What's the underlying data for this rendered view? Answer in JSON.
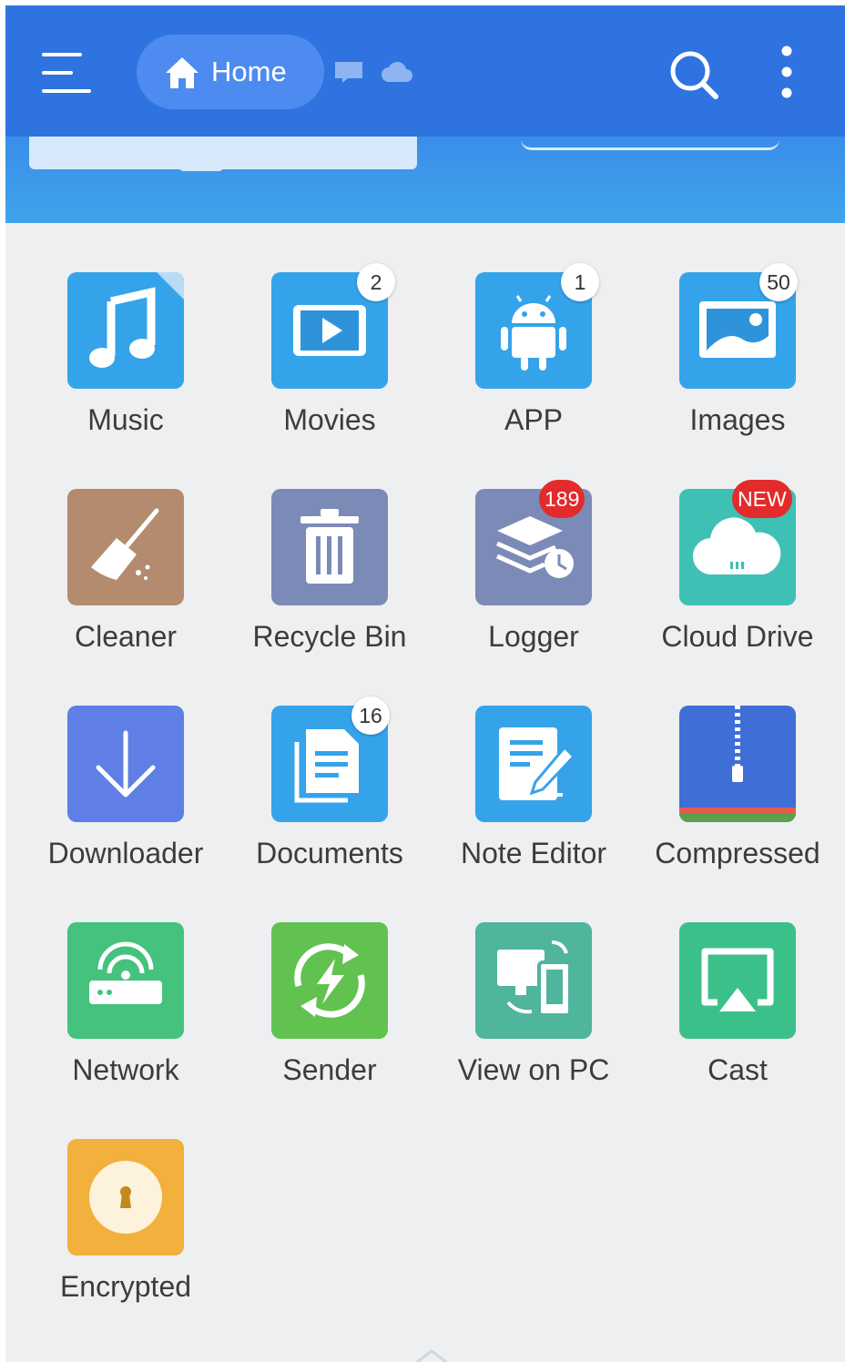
{
  "topbar": {
    "home_label": "Home",
    "colors": {
      "bar": "#2f73e0",
      "chip": "#4e8bf0"
    }
  },
  "grid": {
    "items": [
      {
        "label": "Music",
        "icon": "music-note-icon",
        "color": "#35a3ea"
      },
      {
        "label": "Movies",
        "icon": "play-video-icon",
        "color": "#35a3ea",
        "badge": "2"
      },
      {
        "label": "APP",
        "icon": "android-icon",
        "color": "#35a3ea",
        "badge": "1"
      },
      {
        "label": "Images",
        "icon": "image-icon",
        "color": "#35a3ea",
        "badge": "50"
      },
      {
        "label": "Cleaner",
        "icon": "broom-icon",
        "color": "#b48b6e"
      },
      {
        "label": "Recycle Bin",
        "icon": "trash-icon",
        "color": "#7c8ab8"
      },
      {
        "label": "Logger",
        "icon": "layers-clock-icon",
        "color": "#7c8ab8",
        "badge": "189"
      },
      {
        "label": "Cloud Drive",
        "icon": "cloud-icon",
        "color": "#3fc0b5",
        "badge": "NEW"
      },
      {
        "label": "Downloader",
        "icon": "download-arrow-icon",
        "color": "#5f7fe6"
      },
      {
        "label": "Documents",
        "icon": "document-icon",
        "color": "#35a3ea",
        "badge": "16"
      },
      {
        "label": "Note Editor",
        "icon": "note-edit-icon",
        "color": "#35a3ea"
      },
      {
        "label": "Compressed",
        "icon": "zipper-icon",
        "color": "#3f6fd6"
      },
      {
        "label": "Network",
        "icon": "router-icon",
        "color": "#44c27e"
      },
      {
        "label": "Sender",
        "icon": "sync-bolt-icon",
        "color": "#62c250"
      },
      {
        "label": "View on PC",
        "icon": "pc-phone-icon",
        "color": "#4fb59c"
      },
      {
        "label": "Cast",
        "icon": "cast-screen-icon",
        "color": "#3cc08a"
      },
      {
        "label": "Encrypted",
        "icon": "lock-keyhole-icon",
        "color": "#f2b03c"
      }
    ]
  }
}
